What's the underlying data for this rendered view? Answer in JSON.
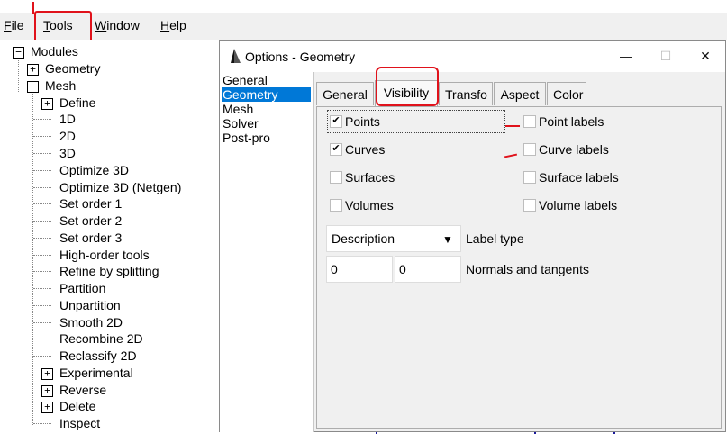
{
  "menubar": {
    "items": [
      {
        "label": "File",
        "mnemonic": "F",
        "rest": "ile"
      },
      {
        "label": "Tools",
        "mnemonic": "T",
        "rest": "ools"
      },
      {
        "label": "Window",
        "mnemonic": "W",
        "rest": "indow"
      },
      {
        "label": "Help",
        "mnemonic": "H",
        "rest": "elp"
      }
    ]
  },
  "tree": {
    "root": "Modules",
    "geometry": "Geometry",
    "mesh": "Mesh",
    "mesh_children": [
      "Define",
      "1D",
      "2D",
      "3D",
      "Optimize 3D",
      "Optimize 3D (Netgen)",
      "Set order 1",
      "Set order 2",
      "Set order 3",
      "High-order tools",
      "Refine by splitting",
      "Partition",
      "Unpartition",
      "Smooth 2D",
      "Recombine 2D",
      "Reclassify 2D",
      "Experimental",
      "Reverse",
      "Delete",
      "Inspect"
    ]
  },
  "dialog": {
    "title": "Options - Geometry",
    "minimize": "—",
    "maximize": "☐",
    "close": "✕",
    "nav": [
      "General",
      "Geometry",
      "Mesh",
      "Solver",
      "Post-pro"
    ],
    "selected_nav": "Geometry",
    "tabs": [
      "General",
      "Visibility",
      "Transfo",
      "Aspect",
      "Color"
    ],
    "active_tab": "Visibility",
    "checks": {
      "points": {
        "label": "Points",
        "checked": true
      },
      "curves": {
        "label": "Curves",
        "checked": true
      },
      "surfaces": {
        "label": "Surfaces",
        "checked": false
      },
      "volumes": {
        "label": "Volumes",
        "checked": false
      },
      "point_labels": {
        "label": "Point labels",
        "checked": false
      },
      "curve_labels": {
        "label": "Curve labels",
        "checked": false
      },
      "surface_labels": {
        "label": "Surface labels",
        "checked": false
      },
      "volume_labels": {
        "label": "Volume labels",
        "checked": false
      }
    },
    "label_type": {
      "value": "Description",
      "label": "Label type"
    },
    "normals": {
      "value1": "0",
      "value2": "0",
      "label": "Normals and tangents"
    }
  },
  "colors": {
    "accent": "#0078d7",
    "annotation": "#e0121b"
  }
}
